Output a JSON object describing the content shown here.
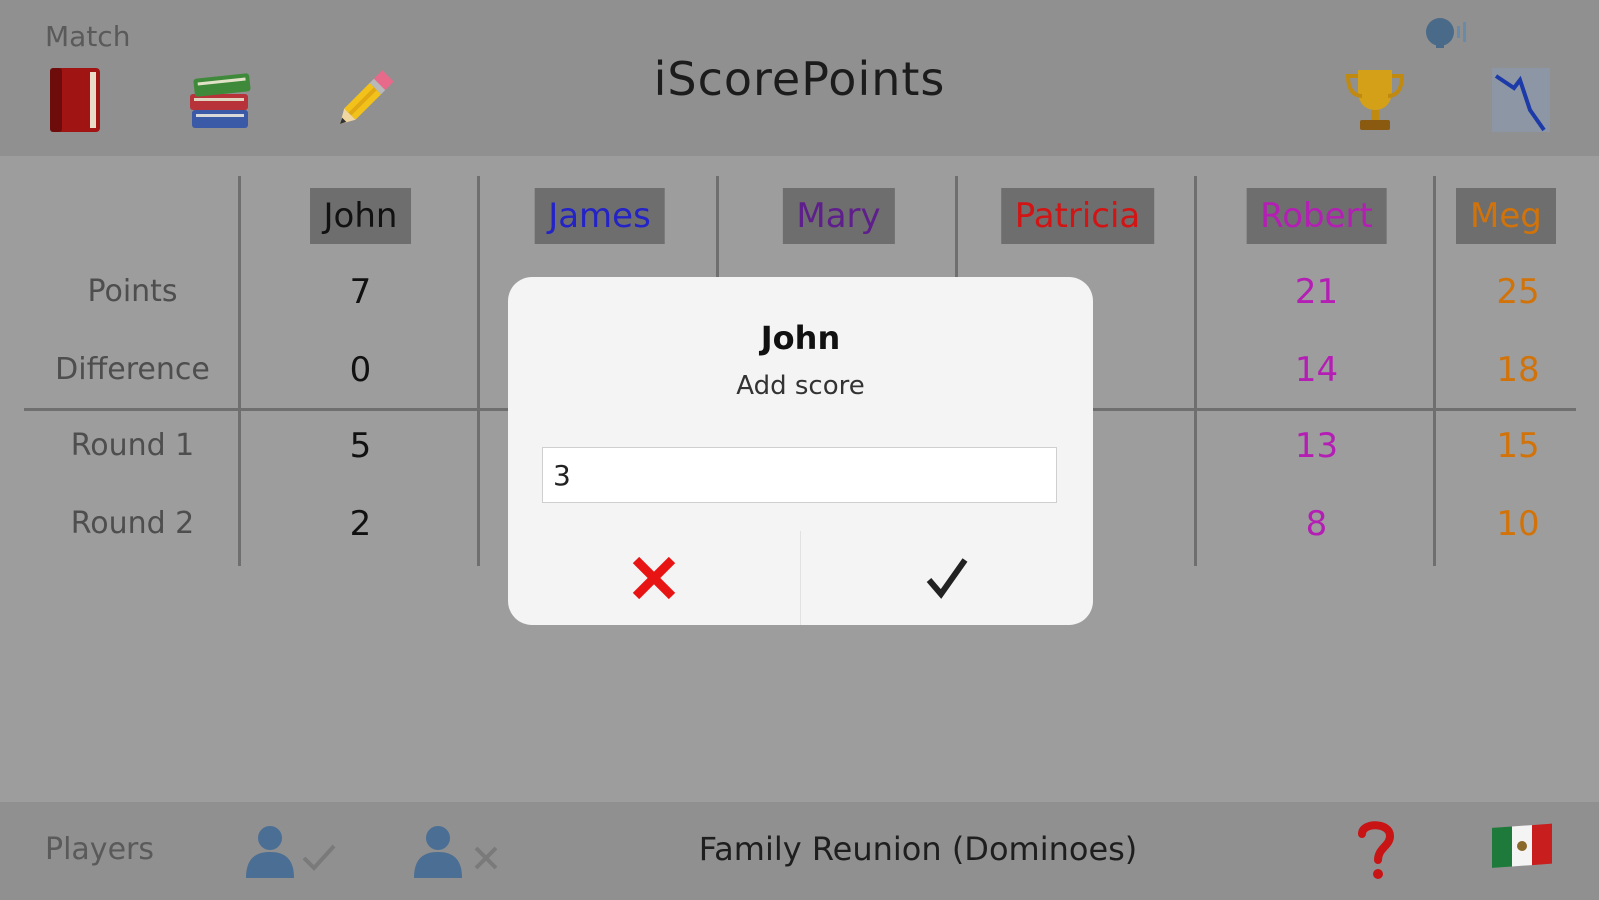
{
  "header": {
    "match_label": "Match",
    "title": "iScorePoints",
    "icons": [
      "book-icon",
      "books-stack-icon",
      "pencil-icon",
      "speaker-icon",
      "trophy-icon",
      "chart-icon"
    ]
  },
  "rows": {
    "points": "Points",
    "difference": "Difference",
    "round1": "Round 1",
    "round2": "Round 2"
  },
  "players": [
    {
      "name": "John",
      "color": "#111111",
      "points": "7",
      "difference": "0",
      "round1": "5",
      "round2": "2"
    },
    {
      "name": "James",
      "color": "#2323c8",
      "points": "",
      "difference": "",
      "round1": "",
      "round2": ""
    },
    {
      "name": "Mary",
      "color": "#5e1e8c",
      "points": "",
      "difference": "",
      "round1": "",
      "round2": ""
    },
    {
      "name": "Patricia",
      "color": "#d21414",
      "points": "",
      "difference": "",
      "round1": "",
      "round2": ""
    },
    {
      "name": "Robert",
      "color": "#b41eb4",
      "points": "21",
      "difference": "14",
      "round1": "13",
      "round2": "8"
    },
    {
      "name": "Meg",
      "color": "#d2730a",
      "points": "25",
      "difference": "18",
      "round1": "15",
      "round2": "10"
    }
  ],
  "footer": {
    "players_label": "Players",
    "match_name": "Family Reunion (Dominoes)",
    "icons": [
      "add-player-icon",
      "remove-player-icon",
      "help-icon",
      "mexico-flag-icon"
    ]
  },
  "dialog": {
    "title": "John",
    "subtitle": "Add score",
    "input_value": "3",
    "cancel_icon": "close-icon",
    "confirm_icon": "checkmark-icon"
  }
}
